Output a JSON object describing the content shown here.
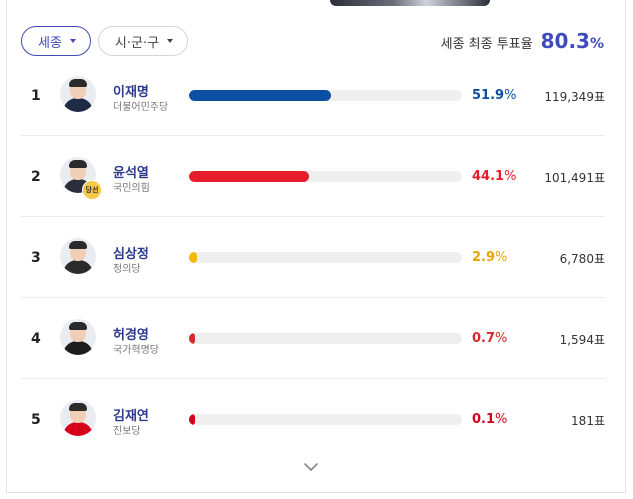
{
  "filters": {
    "region": "세종",
    "district": "시·군·구"
  },
  "turnout": {
    "label": "세종 최종 투표율",
    "value": "80.3",
    "unit": "%"
  },
  "candidates": [
    {
      "rank": "1",
      "name": "이재명",
      "party": "더불어민주당",
      "share": "51.9",
      "votes": "119,349표",
      "color": "#0b4ea2",
      "share_color": "#0b4ea2",
      "elected": false,
      "suit": "#1f2a44"
    },
    {
      "rank": "2",
      "name": "윤석열",
      "party": "국민의힘",
      "share": "44.1",
      "votes": "101,491표",
      "color": "#e61e2b",
      "share_color": "#e61e2b",
      "elected": true,
      "elected_label": "당선",
      "suit": "#2a2f3a"
    },
    {
      "rank": "3",
      "name": "심상정",
      "party": "정의당",
      "share": "2.9",
      "votes": "6,780표",
      "color": "#f5b800",
      "share_color": "#e9a400",
      "elected": false,
      "suit": "#2b2b2b"
    },
    {
      "rank": "4",
      "name": "허경영",
      "party": "국가혁명당",
      "share": "0.7",
      "votes": "1,594표",
      "color": "#d52a2a",
      "share_color": "#d52a2a",
      "elected": false,
      "suit": "#1d1d1d"
    },
    {
      "rank": "5",
      "name": "김재연",
      "party": "진보당",
      "share": "0.1",
      "votes": "181표",
      "color": "#d6001c",
      "share_color": "#d6001c",
      "elected": false,
      "suit": "#d6001c"
    }
  ],
  "share_unit": "%",
  "icons": {
    "dropdown": "caret-down-icon",
    "more": "chevron-down-icon"
  }
}
